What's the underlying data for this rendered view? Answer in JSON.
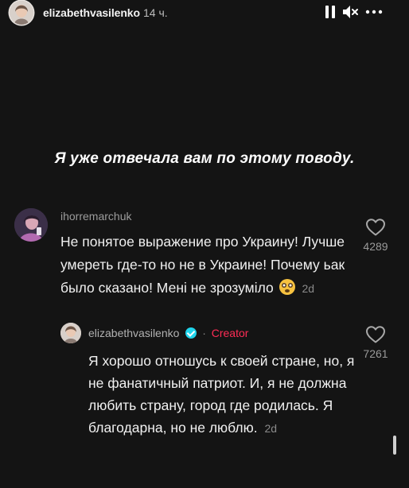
{
  "header": {
    "username": "elizabethvasilenko",
    "time_ago": "14 ч."
  },
  "caption": "Я уже отвечала вам по этому поводу.",
  "comment": {
    "username": "ihorremarchuk",
    "text": "Не понятое выражение про Украину! Лучше умереть где-то но не в Украине! Почему ьак было сказано! Мені не зрозуміло",
    "emoji": "flushed-face",
    "age": "2d",
    "likes": "4289"
  },
  "reply": {
    "username": "elizabethvasilenko",
    "verified": true,
    "separator": "·",
    "badge": "Creator",
    "text": "Я хорошо отношусь к своей стране, но, я не фанатичный патриот. И, я не должна любить страну, город где родилась. Я благодарна, но не люблю.",
    "age": "2d",
    "likes": "7261"
  },
  "colors": {
    "background": "#141414",
    "creator_accent": "#fe2c55",
    "verified": "#20d5ec"
  }
}
